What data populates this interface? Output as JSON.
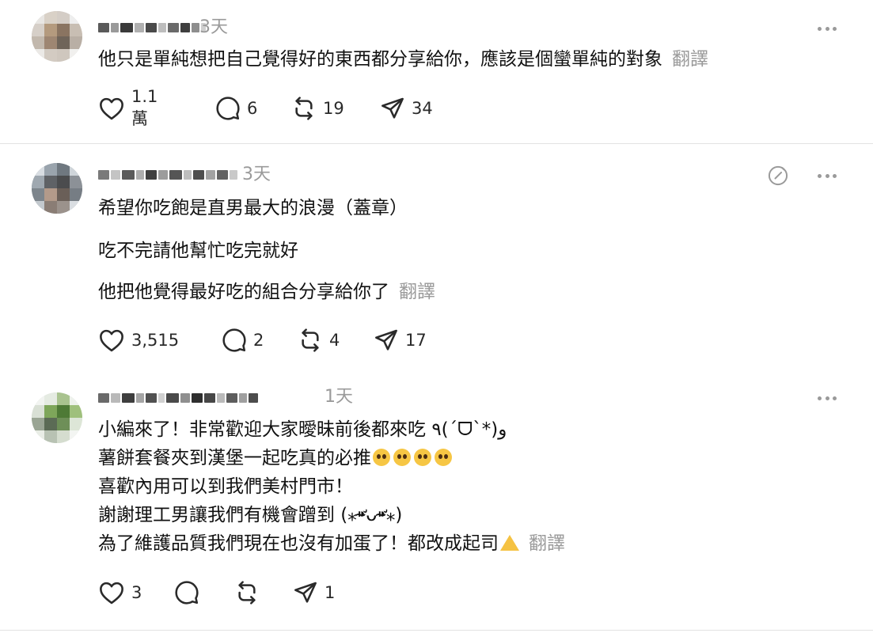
{
  "colors": {
    "text": "#111111",
    "muted": "#9a9a9a",
    "divider": "#e3e3e3",
    "icon": "#2a2a2a"
  },
  "posts": [
    {
      "time": "3天",
      "lines": [
        "他只是單純想把自己覺得好的東西都分享給你，應該是個蠻單純的對象"
      ],
      "translate": "翻譯",
      "likes": "1.1 萬",
      "replies": "6",
      "reposts": "19",
      "shares": "34"
    },
    {
      "time": "3天",
      "lines": [
        "希望你吃飽是直男最大的浪漫（蓋章）",
        "吃不完請他幫忙吃完就好",
        "他把他覺得最好吃的組合分享給你了"
      ],
      "translate": "翻譯",
      "likes": "3,515",
      "replies": "2",
      "reposts": "4",
      "shares": "17"
    },
    {
      "time": "1天",
      "lines": [
        "小編來了！非常歡迎大家曖昧前後都來吃 ٩(ˊᗜˋ*)و",
        "薯餅套餐夾到漢堡一起吃真的必推",
        "喜歡內用可以到我們美村門市！",
        "謝謝理工男讓我們有機會蹭到 (⁎⁍̴̛ᴗ⁍̴̛⁎)",
        "為了維護品質我們現在也沒有加蛋了！都改成起司"
      ],
      "translate": "翻譯",
      "likes": "3",
      "replies": "",
      "reposts": "",
      "shares": "1"
    }
  ],
  "icons": {
    "like": "heart-icon",
    "reply": "comment-icon",
    "repost": "repost-icon",
    "share": "send-icon",
    "more": "more-icon",
    "edit": "edit-off-icon",
    "pleading": "pleading-face-emoji",
    "cheese": "cheese-emoji"
  }
}
